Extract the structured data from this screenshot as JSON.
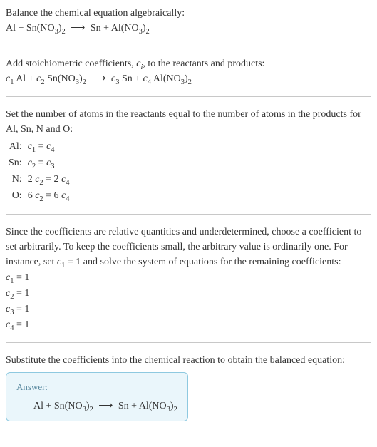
{
  "sec1": {
    "line1": "Balance the chemical equation algebraically:",
    "eq_lhs1": "Al + Sn(NO",
    "eq_sub1": "3",
    "eq_rhs1": ")",
    "eq_sub2": "2",
    "arrow": "⟶",
    "eq_lhs2": "Sn + Al(NO",
    "eq_sub3": "3",
    "eq_rhs2": ")",
    "eq_sub4": "2"
  },
  "sec2": {
    "line1a": "Add stoichiometric coefficients, ",
    "ci": "c",
    "ci_sub": "i",
    "line1b": ", to the reactants and products:",
    "c1": "c",
    "c1s": "1",
    "t1": " Al + ",
    "c2": "c",
    "c2s": "2",
    "t2": " Sn(NO",
    "t2sub": "3",
    "t2b": ")",
    "t2sub2": "2",
    "arrow": "⟶",
    "c3": "c",
    "c3s": "3",
    "t3": " Sn + ",
    "c4": "c",
    "c4s": "4",
    "t4": " Al(NO",
    "t4sub": "3",
    "t4b": ")",
    "t4sub2": "2"
  },
  "sec3": {
    "intro1": "Set the number of atoms in the reactants equal to the number of atoms in the products for Al, Sn, N and O:",
    "rows": {
      "al_label": "Al:",
      "al_eq_c1": "c",
      "al_eq_c1s": "1",
      "al_eq_mid": " = ",
      "al_eq_c4": "c",
      "al_eq_c4s": "4",
      "sn_label": "Sn:",
      "sn_eq_c2": "c",
      "sn_eq_c2s": "2",
      "sn_eq_mid": " = ",
      "sn_eq_c3": "c",
      "sn_eq_c3s": "3",
      "n_label": "N:",
      "n_eq_l": "2 ",
      "n_eq_c2": "c",
      "n_eq_c2s": "2",
      "n_eq_mid": " = 2 ",
      "n_eq_c4": "c",
      "n_eq_c4s": "4",
      "o_label": "O:",
      "o_eq_l": "6 ",
      "o_eq_c2": "c",
      "o_eq_c2s": "2",
      "o_eq_mid": " = 6 ",
      "o_eq_c4": "c",
      "o_eq_c4s": "4"
    }
  },
  "sec4": {
    "intro_a": "Since the coefficients are relative quantities and underdetermined, choose a coefficient to set arbitrarily. To keep the coefficients small, the arbitrary value is ordinarily one. For instance, set ",
    "c1": "c",
    "c1s": "1",
    "intro_b": " = 1 and solve the system of equations for the remaining coefficients:",
    "eq1_c": "c",
    "eq1_s": "1",
    "eq1_v": " = 1",
    "eq2_c": "c",
    "eq2_s": "2",
    "eq2_v": " = 1",
    "eq3_c": "c",
    "eq3_s": "3",
    "eq3_v": " = 1",
    "eq4_c": "c",
    "eq4_s": "4",
    "eq4_v": " = 1"
  },
  "sec5": {
    "intro": "Substitute the coefficients into the chemical reaction to obtain the balanced equation:",
    "answer_label": "Answer:",
    "eq_lhs1": "Al + Sn(NO",
    "eq_sub1": "3",
    "eq_rhs1": ")",
    "eq_sub2": "2",
    "arrow": "⟶",
    "eq_lhs2": "Sn + Al(NO",
    "eq_sub3": "3",
    "eq_rhs2": ")",
    "eq_sub4": "2"
  }
}
